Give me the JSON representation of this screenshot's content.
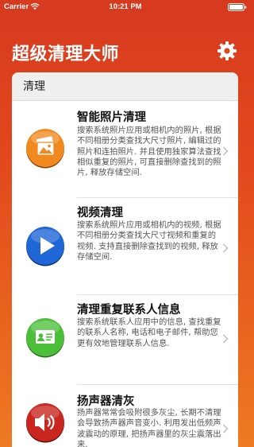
{
  "status_bar": {
    "carrier": "Carrier",
    "time": "10:21 PM",
    "wifi_icon": "wifi-icon",
    "battery_icon": "battery-icon"
  },
  "header": {
    "title": "超级清理大师",
    "settings_icon": "gear-icon"
  },
  "colors": {
    "background_top": "#d63a1f",
    "background_bottom": "#ee7a24",
    "photos_icon": "#f0891e",
    "video_icon": "#1f66d6",
    "contacts_icon": "#4cbf39",
    "speaker_icon": "#c8261e"
  },
  "section": {
    "header": "清理",
    "items": [
      {
        "title": "智能照片清理",
        "description": "搜索系统照片应用或相机内的照片, 根据不同相册分类查找大尺寸照片, 编辑过的照片和连拍照片. 并且使用独家算法查找相似重复的照片, 可直接删除查找到的照片, 释放存储空间.",
        "icon": "photos-icon"
      },
      {
        "title": "视频清理",
        "description": "搜索系统照片应用或相机内的视频, 根据不同相册分类查找大尺寸视频和重复的视频. 支持直接删除查找到的视频, 释放存储空间.",
        "icon": "play-icon"
      },
      {
        "title": "清理重复联系人信息",
        "description": "搜索系统联系人应用中的信息, 查找重复的联系人名称, 电话和电子邮件, 帮助您更有效地管理联系人信息.",
        "icon": "contact-card-icon"
      },
      {
        "title": "扬声器清灰",
        "description": "扬声器常常会吸附很多灰尘, 长期不清理会导致扬声器声音变小. 利用发出低频声波震动的原理, 把扬声器里的灰尘震落出来.",
        "icon": "speaker-icon"
      }
    ]
  }
}
